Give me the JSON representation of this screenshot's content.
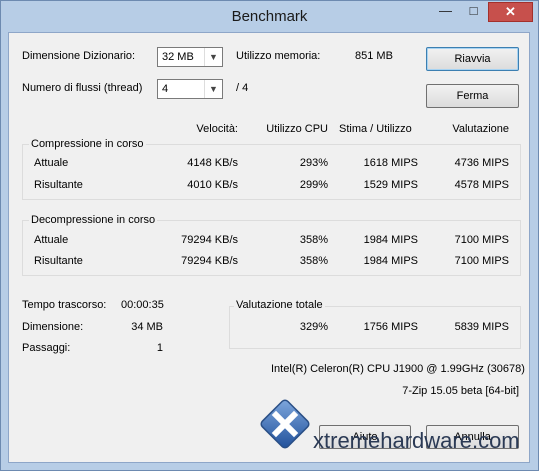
{
  "window": {
    "title": "Benchmark",
    "minimize_glyph": "—",
    "maximize_glyph": "□",
    "close_glyph": "✕"
  },
  "settings": {
    "dict_label": "Dimensione Dizionario:",
    "dict_value": "32 MB",
    "threads_label": "Numero di flussi (thread)",
    "threads_value": "4",
    "threads_total": "/ 4",
    "mem_label": "Utilizzo memoria:",
    "mem_value": "851 MB"
  },
  "buttons": {
    "restart": "Riavvia",
    "stop": "Ferma",
    "ok": "Aiuto",
    "cancel": "Annulla"
  },
  "headers": {
    "speed": "Velocità:",
    "cpu": "Utilizzo CPU",
    "estimate": "Stima / Utilizzo",
    "rating": "Valutazione"
  },
  "compression": {
    "title": "Compressione in corso",
    "rows": [
      {
        "label": "Attuale",
        "speed": "4148 KB/s",
        "cpu": "293%",
        "estimate": "1618 MIPS",
        "rating": "4736 MIPS"
      },
      {
        "label": "Risultante",
        "speed": "4010 KB/s",
        "cpu": "299%",
        "estimate": "1529 MIPS",
        "rating": "4578 MIPS"
      }
    ]
  },
  "decompression": {
    "title": "Decompressione in corso",
    "rows": [
      {
        "label": "Attuale",
        "speed": "79294 KB/s",
        "cpu": "358%",
        "estimate": "1984 MIPS",
        "rating": "7100 MIPS"
      },
      {
        "label": "Risultante",
        "speed": "79294 KB/s",
        "cpu": "358%",
        "estimate": "1984 MIPS",
        "rating": "7100 MIPS"
      }
    ]
  },
  "stats": {
    "elapsed_label": "Tempo trascorso:",
    "elapsed_value": "00:00:35",
    "size_label": "Dimensione:",
    "size_value": "34 MB",
    "passes_label": "Passaggi:",
    "passes_value": "1"
  },
  "total": {
    "title": "Valutazione totale",
    "cpu": "329%",
    "estimate": "1756 MIPS",
    "rating": "5839 MIPS"
  },
  "cpu_info": "Intel(R) Celeron(R) CPU  J1900  @ 1.99GHz (30678)",
  "version": "7-Zip 15.05 beta [64-bit]",
  "watermark": "xtremehardware.com"
}
